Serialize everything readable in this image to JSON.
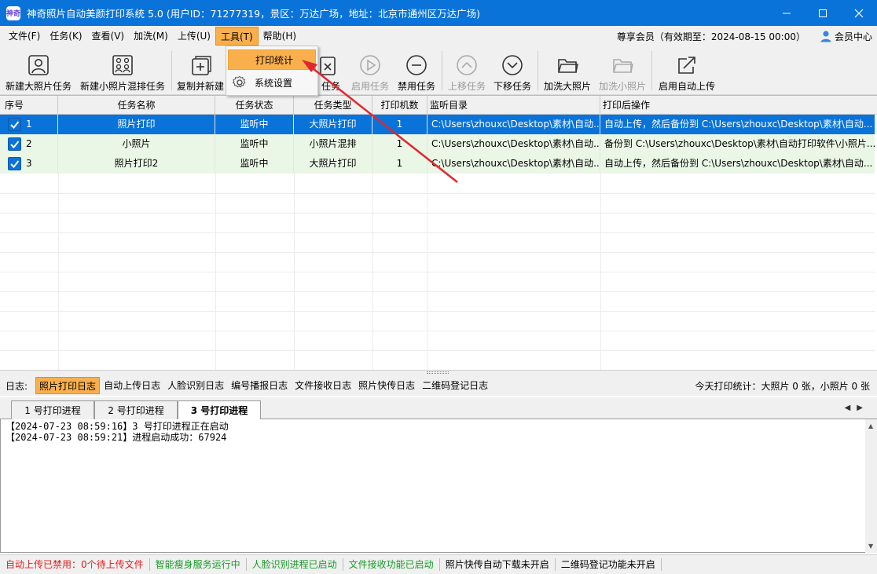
{
  "window": {
    "app_icon_text": "神奇",
    "title": "神奇照片自动美颜打印系统 5.0 (用户ID：71277319，景区：万达广场，地址：北京市通州区万达广场)"
  },
  "menu": {
    "items": [
      "文件(F)",
      "任务(K)",
      "查看(V)",
      "加洗(M)",
      "上传(U)",
      "工具(T)",
      "帮助(H)"
    ],
    "active": "工具(T)",
    "membership": "尊享会员（有效期至：2024-08-15 00:00）",
    "member_center": "会员中心"
  },
  "tools_dropdown": {
    "items": [
      {
        "label": "打印统计",
        "icon": "none",
        "highlighted": true
      },
      {
        "label": "系统设置",
        "icon": "gear-icon",
        "highlighted": false
      }
    ]
  },
  "toolbar": {
    "buttons": [
      {
        "label": "新建大照片任务",
        "icon": "portrait-icon",
        "enabled": true
      },
      {
        "label": "新建小照片混排任务",
        "icon": "grid-portraits-icon",
        "enabled": true
      },
      {
        "label": "复制并新建",
        "icon": "copy-add-icon",
        "enabled": true
      },
      {
        "label": "任务",
        "icon": "delete-task-icon",
        "enabled": true
      },
      {
        "label": "启用任务",
        "icon": "play-circle-icon",
        "enabled": false
      },
      {
        "label": "禁用任务",
        "icon": "minus-circle-icon",
        "enabled": true
      },
      {
        "label": "上移任务",
        "icon": "chevron-up-circle-icon",
        "enabled": false
      },
      {
        "label": "下移任务",
        "icon": "chevron-down-circle-icon",
        "enabled": true
      },
      {
        "label": "加洗大照片",
        "icon": "folder-icon",
        "enabled": true
      },
      {
        "label": "加洗小照片",
        "icon": "folder-icon",
        "enabled": false
      },
      {
        "label": "启用自动上传",
        "icon": "upload-arrow-icon",
        "enabled": true
      }
    ]
  },
  "table": {
    "columns": [
      "序号",
      "任务名称",
      "任务状态",
      "任务类型",
      "打印机数",
      "监听目录",
      "打印后操作"
    ],
    "rows": [
      {
        "no": "1",
        "name": "照片打印",
        "status": "监听中",
        "type": "大照片打印",
        "printers": "1",
        "dir": "C:\\Users\\zhouxc\\Desktop\\素材\\自动...",
        "after": "自动上传，然后备份到 C:\\Users\\zhouxc\\Desktop\\素材\\自动...",
        "checked": true
      },
      {
        "no": "2",
        "name": "小照片",
        "status": "监听中",
        "type": "小照片混排",
        "printers": "1",
        "dir": "C:\\Users\\zhouxc\\Desktop\\素材\\自动...",
        "after": "备份到 C:\\Users\\zhouxc\\Desktop\\素材\\自动打印软件\\小照片...",
        "checked": true
      },
      {
        "no": "3",
        "name": "照片打印2",
        "status": "监听中",
        "type": "大照片打印",
        "printers": "1",
        "dir": "C:\\Users\\zhouxc\\Desktop\\素材\\自动...",
        "after": "自动上传，然后备份到 C:\\Users\\zhouxc\\Desktop\\素材\\自动...",
        "checked": true
      }
    ],
    "selected_row": 0
  },
  "logbar": {
    "label": "日志:",
    "tabs": [
      "照片打印日志",
      "自动上传日志",
      "人脸识别日志",
      "编号播报日志",
      "文件接收日志",
      "照片快传日志",
      "二维码登记日志"
    ],
    "active": "照片打印日志",
    "today_stats": "今天打印统计：大照片 0 张，小照片 0 张"
  },
  "process_tabs": {
    "items": [
      "1 号打印进程",
      "2 号打印进程",
      "3 号打印进程"
    ],
    "active": "3 号打印进程"
  },
  "log_lines": [
    "【2024-07-23 08:59:16】3 号打印进程正在启动",
    "【2024-07-23 08:59:21】进程启动成功：67924"
  ],
  "statusbar": [
    {
      "text": "自动上传已禁用：0个待上传文件",
      "color": "#e02020"
    },
    {
      "text": "智能瘦身服务运行中",
      "color": "#1a9a2a"
    },
    {
      "text": "人脸识别进程已启动",
      "color": "#1a9a2a"
    },
    {
      "text": "文件接收功能已启动",
      "color": "#1a9a2a"
    },
    {
      "text": "照片快传自动下载未开启",
      "color": "#000000"
    },
    {
      "text": "二维码登记功能未开启",
      "color": "#000000"
    }
  ],
  "colors": {
    "titlebar": "#0a73d9",
    "accent_orange": "#f9b04c",
    "selected_row": "#0a73d9",
    "alt_row": "#eaf7e6",
    "annotation_arrow": "#e0282e"
  }
}
